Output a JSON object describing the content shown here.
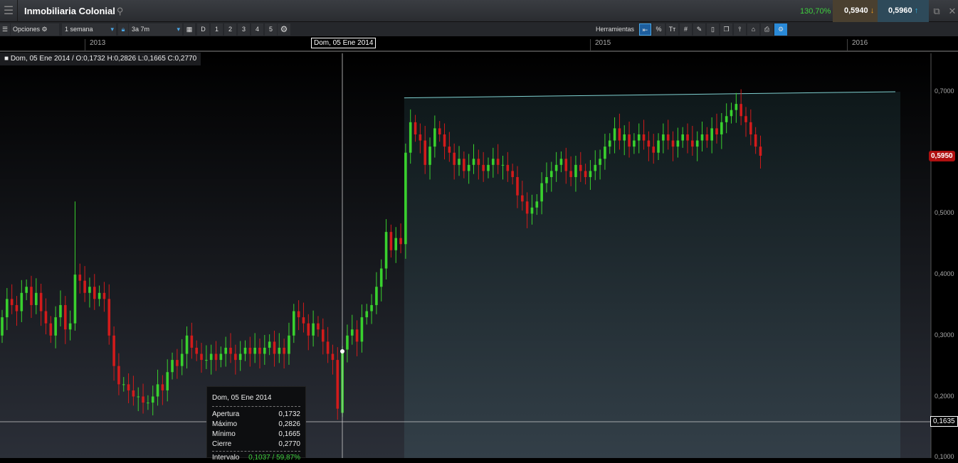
{
  "header": {
    "title": "Inmobiliaria Colonial",
    "change_pct": "130,70%",
    "bid": "0,5940",
    "ask": "0,5960"
  },
  "toolbar": {
    "options": "Opciones",
    "interval": "1 semana",
    "range": "3a 7m",
    "buttons": [
      "D",
      "1",
      "2",
      "3",
      "4",
      "5"
    ],
    "tools_label": "Herramientas",
    "tool_icons": [
      "arrow-left-icon",
      "percent-icon",
      "text-size-icon",
      "grid-icon",
      "draw-icon",
      "candle-icon",
      "layers-icon",
      "indicator-icon",
      "label-icon",
      "print-icon",
      "settings-draw-icon"
    ]
  },
  "time_axis": {
    "years": [
      "2013",
      "2015",
      "2016"
    ],
    "cursor_date": "Dom, 05 Ene 2014"
  },
  "ohlc_bar": "Dom, 05 Ene 2014 / O:0,1732  H:0,2826  L:0,1665  C:0,2770",
  "tooltip": {
    "date": "Dom, 05 Ene 2014",
    "rows": [
      {
        "k": "Apertura",
        "v": "0,1732"
      },
      {
        "k": "Máximo",
        "v": "0,2826"
      },
      {
        "k": "Mínimo",
        "v": "0,1665"
      },
      {
        "k": "Cierre",
        "v": "0,2770"
      }
    ],
    "interval_label": "Intervalo",
    "interval_value": "0,1037 / 59,87%"
  },
  "price_axis": {
    "ticks": [
      "0,7000",
      "0,5000",
      "0,4000",
      "0,3000",
      "0,2000",
      "0,1000"
    ],
    "last_price": "0,5950",
    "cursor_price": "0,1635"
  },
  "colors": {
    "up": "#39d12e",
    "down": "#d21b1b",
    "trend": "#7fd0d0"
  },
  "chart_data": {
    "type": "candlestick",
    "interval": "weekly",
    "ylim": [
      0.1,
      0.7
    ],
    "first_open": 0.3,
    "close": [
      0.33,
      0.36,
      0.35,
      0.34,
      0.37,
      0.38,
      0.35,
      0.37,
      0.34,
      0.32,
      0.3,
      0.33,
      0.35,
      0.31,
      0.32,
      0.4,
      0.39,
      0.37,
      0.38,
      0.36,
      0.37,
      0.36,
      0.3,
      0.25,
      0.22,
      0.22,
      0.21,
      0.2,
      0.2,
      0.19,
      0.19,
      0.2,
      0.22,
      0.21,
      0.24,
      0.26,
      0.25,
      0.27,
      0.3,
      0.28,
      0.27,
      0.26,
      0.26,
      0.27,
      0.26,
      0.27,
      0.28,
      0.27,
      0.26,
      0.27,
      0.28,
      0.27,
      0.28,
      0.27,
      0.28,
      0.29,
      0.27,
      0.28,
      0.27,
      0.3,
      0.34,
      0.33,
      0.32,
      0.3,
      0.32,
      0.31,
      0.29,
      0.27,
      0.26,
      0.18,
      0.277,
      0.3,
      0.31,
      0.29,
      0.33,
      0.34,
      0.35,
      0.38,
      0.41,
      0.47,
      0.44,
      0.46,
      0.45,
      0.6,
      0.65,
      0.63,
      0.62,
      0.58,
      0.61,
      0.64,
      0.63,
      0.61,
      0.6,
      0.58,
      0.59,
      0.57,
      0.58,
      0.59,
      0.58,
      0.57,
      0.58,
      0.59,
      0.58,
      0.58,
      0.57,
      0.56,
      0.53,
      0.52,
      0.5,
      0.51,
      0.52,
      0.55,
      0.56,
      0.57,
      0.58,
      0.59,
      0.57,
      0.56,
      0.58,
      0.57,
      0.56,
      0.57,
      0.58,
      0.59,
      0.61,
      0.62,
      0.64,
      0.62,
      0.63,
      0.61,
      0.62,
      0.63,
      0.62,
      0.61,
      0.6,
      0.62,
      0.63,
      0.62,
      0.61,
      0.62,
      0.63,
      0.62,
      0.61,
      0.62,
      0.63,
      0.62,
      0.64,
      0.63,
      0.65,
      0.66,
      0.67,
      0.68,
      0.66,
      0.65,
      0.63,
      0.61,
      0.595
    ],
    "special": {
      "15": {
        "h": 0.52
      },
      "70": {
        "o": 0.1732,
        "h": 0.2826,
        "l": 0.1665,
        "c": 0.277
      }
    },
    "trendline": {
      "from": 0.69,
      "to": 0.7
    }
  }
}
